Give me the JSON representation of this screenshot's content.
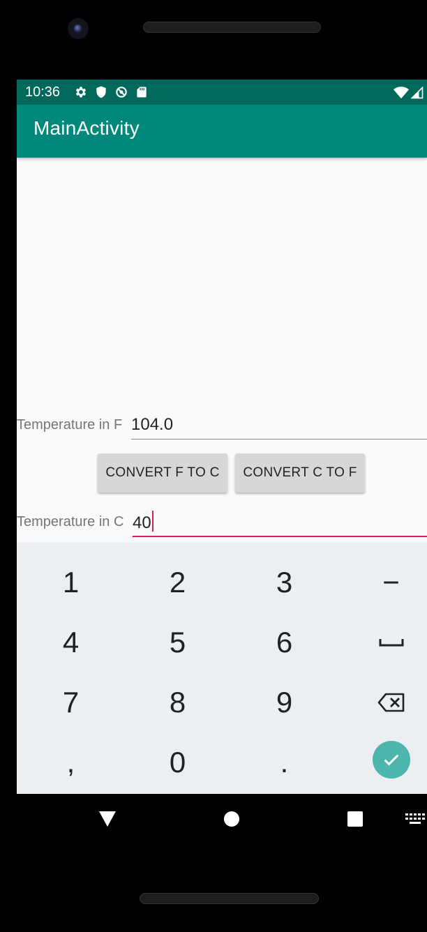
{
  "status_bar": {
    "time": "10:36",
    "icons_left": [
      "settings-icon",
      "shield-icon",
      "data-saver-icon",
      "sd-card-icon"
    ],
    "icons_right": [
      "wifi-icon",
      "cellular-signal-icon"
    ]
  },
  "app_bar": {
    "title": "MainActivity",
    "color": "#00897b",
    "status_color": "#00695c"
  },
  "form": {
    "fahrenheit_label": "Temperature in F",
    "fahrenheit_value": "104.0",
    "convert_f_to_c_label": "CONVERT F TO C",
    "convert_c_to_f_label": "CONVERT C TO F",
    "celsius_label": "Temperature in C",
    "celsius_value": "40",
    "accent_color": "#d81b60"
  },
  "keyboard": {
    "rows": [
      [
        "1",
        "2",
        "3",
        "−"
      ],
      [
        "4",
        "5",
        "6",
        "space-icon"
      ],
      [
        "7",
        "8",
        "9",
        "backspace-icon"
      ],
      [
        ",",
        "0",
        ".",
        "done-check-icon"
      ]
    ],
    "key_1": "1",
    "key_2": "2",
    "key_3": "3",
    "key_minus": "−",
    "key_4": "4",
    "key_5": "5",
    "key_6": "6",
    "key_7": "7",
    "key_8": "8",
    "key_9": "9",
    "key_comma": ",",
    "key_0": "0",
    "key_period": "."
  },
  "nav_bar": {
    "buttons": [
      "back-icon",
      "home-icon",
      "recents-icon",
      "keyboard-switch-icon"
    ]
  }
}
